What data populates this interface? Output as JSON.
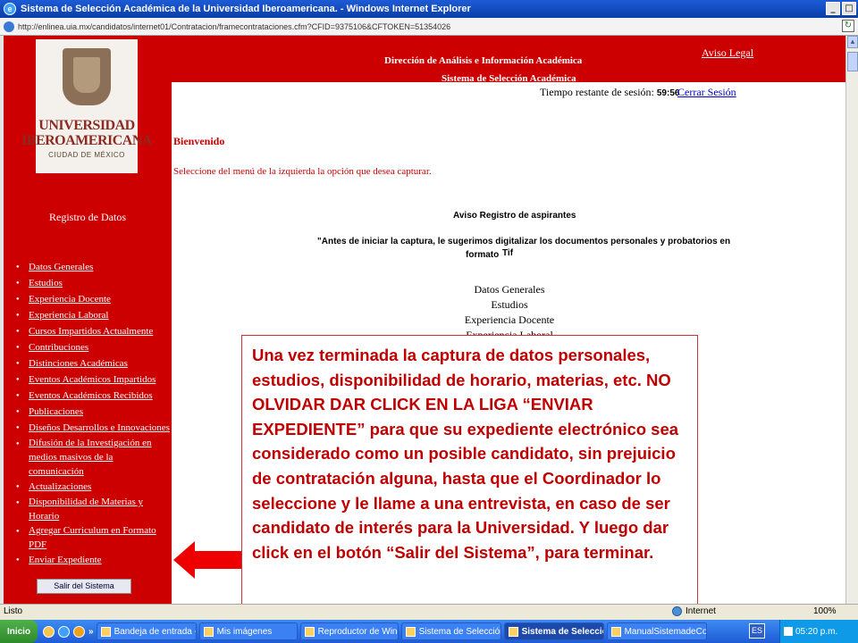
{
  "window": {
    "title": "Sistema de Selección Académica de la Universidad Iberoamericana. - Windows Internet Explorer"
  },
  "address": {
    "url": "http://enlinea.uia.mx/candidatos/internet01/Contratacion/framecontrataciones.cfm?CFID=9375106&CFTOKEN=51354026"
  },
  "header": {
    "line1": "Dirección de Análisis e Información Académica",
    "line2": "Sistema de Selección Académica",
    "aviso_legal": "Aviso Legal"
  },
  "logo": {
    "line1": "UNIVERSIDAD",
    "line2": "IBEROAMERICANA",
    "line3": "CIUDAD DE MÉXICO"
  },
  "session": {
    "label": "Tiempo restante de sesión:",
    "time": "59:56",
    "logout": "Cerrar Sesión"
  },
  "sidebar": {
    "title": "Registro de Datos",
    "items": [
      "Datos Generales",
      "Estudios",
      "Experiencia Docente",
      "Experiencia Laboral",
      "Cursos Impartidos Actualmente",
      "Contribuciones",
      "Distinciones Académicas",
      "Eventos Académicos Impartidos",
      "Eventos Académicos Recibidos",
      "Publicaciones",
      "Diseños Desarrollos e Innovaciones",
      "Difusión de la Investigación en medios masivos de la comunicación",
      "Actualizaciones",
      "Disponibilidad de Materias y Horario",
      "Agregar Curriculum en Formato PDF",
      "Enviar Expediente"
    ],
    "logout_button": "Salir del Sistema"
  },
  "main": {
    "welcome": "Bienvenido",
    "instruction": "Seleccione del menú de la izquierda la opción que desea capturar.",
    "notice_title": "Aviso Registro de aspirantes",
    "notice_line1": "\"Antes de iniciar la captura, le sugerimos digitalizar los documentos personales y probatorios en",
    "notice_line2": "formato",
    "notice_format": "Tif",
    "docs": [
      "Datos Generales",
      "Estudios",
      "Experiencia Docente",
      "Experiencia Laboral"
    ]
  },
  "callout": {
    "text": "Una vez terminada la captura de datos personales, estudios, disponibilidad de horario, materias, etc. NO OLVIDAR DAR CLICK EN LA LIGA “ENVIAR EXPEDIENTE” para que su expediente electrónico sea considerado como un posible candidato, sin prejuicio de contratación alguna, hasta que el Coordinador lo seleccione y le llame a una entrevista, en caso de ser candidato de interés para la Universidad. Y luego dar click en el botón “Salir del Sistema”, para terminar."
  },
  "status": {
    "left": "Listo",
    "zone": "Internet",
    "zoom": "100%"
  },
  "taskbar": {
    "start": "Inicio",
    "more": "»",
    "tasks": [
      "Bandeja de entrada - Mic...",
      "Mis imágenes",
      "Reproductor de Window...",
      "Sistema de Selección Aca...",
      "Sistema de Selección ...",
      "ManualSistemadeContrat..."
    ],
    "lang": "ES",
    "clock": "05:20 p.m."
  },
  "colors": {
    "uia_red": "#cc0000",
    "callout_red": "#c00000",
    "link_blue": "#0000cc"
  }
}
